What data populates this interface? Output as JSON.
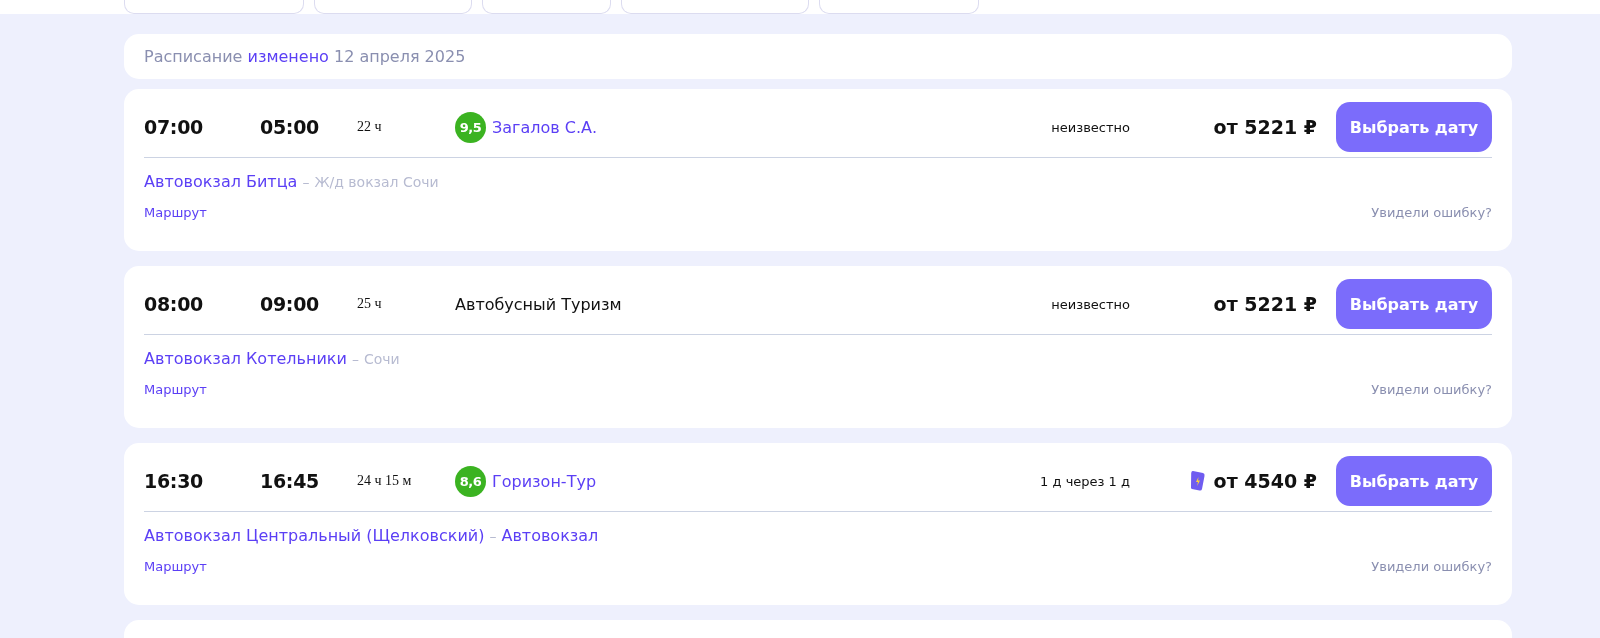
{
  "notice": {
    "text": "Расписание **изменено** 12 апреля 2025"
  },
  "trips": [
    {
      "departure": "07:00",
      "arrival": "05:00",
      "duration": "22 ч",
      "rating": "9,5",
      "carrier": "Загалов С.А.",
      "carrier_linked": true,
      "status": "неизвестно",
      "e_ticket": false,
      "price": "от 5221 ₽",
      "button": "Выбрать дату",
      "from": "Автовокзал Битца",
      "separator": "–",
      "to": "Ж/д вокзал Сочи",
      "to_linked": false,
      "route_link": "Маршрут",
      "report_link": "Увидели ошибку?"
    },
    {
      "departure": "08:00",
      "arrival": "09:00",
      "duration": "25 ч",
      "carrier": "Автобусный Туризм",
      "carrier_linked": false,
      "status": "неизвестно",
      "e_ticket": false,
      "price": "от 5221 ₽",
      "button": "Выбрать дату",
      "from": "Автовокзал Котельники",
      "separator": "–",
      "to": "Сочи",
      "to_linked": false,
      "route_link": "Маршрут",
      "report_link": "Увидели ошибку?"
    },
    {
      "departure": "16:30",
      "arrival": "16:45",
      "duration": "24 ч 15 м",
      "rating": "8,6",
      "carrier": "Горизон-Тур",
      "carrier_linked": true,
      "status": "1 д через 1 д",
      "e_ticket": true,
      "price": "от 4540 ₽",
      "button": "Выбрать дату",
      "from": "Автовокзал Центральный (Щелковский)",
      "separator": "–",
      "to": "Автовокзал",
      "to_linked": true,
      "route_link": "Маршрут",
      "report_link": "Увидели ошибку?"
    }
  ]
}
